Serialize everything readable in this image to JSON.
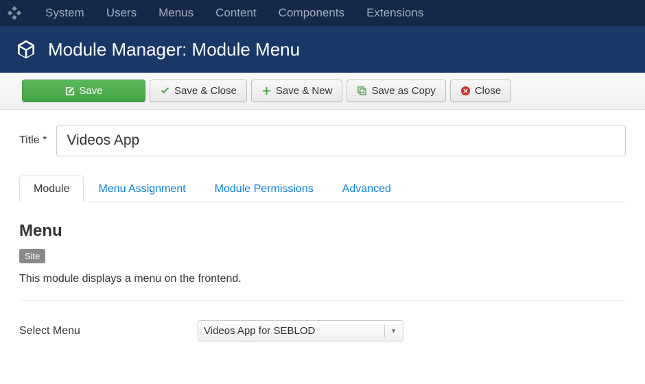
{
  "nav": {
    "items": [
      "System",
      "Users",
      "Menus",
      "Content",
      "Components",
      "Extensions"
    ]
  },
  "titlebar": {
    "text": "Module Manager: Module Menu"
  },
  "toolbar": {
    "save": "Save",
    "save_close": "Save & Close",
    "save_new": "Save & New",
    "save_copy": "Save as Copy",
    "close": "Close"
  },
  "title_field": {
    "label": "Title *",
    "value": "Videos App"
  },
  "tabs": {
    "items": [
      "Module",
      "Menu Assignment",
      "Module Permissions",
      "Advanced"
    ],
    "active": 0
  },
  "module_section": {
    "heading": "Menu",
    "badge": "Site",
    "description": "This module displays a menu on the frontend.",
    "select_menu_label": "Select Menu",
    "select_menu_value": "Videos App for SEBLOD"
  }
}
